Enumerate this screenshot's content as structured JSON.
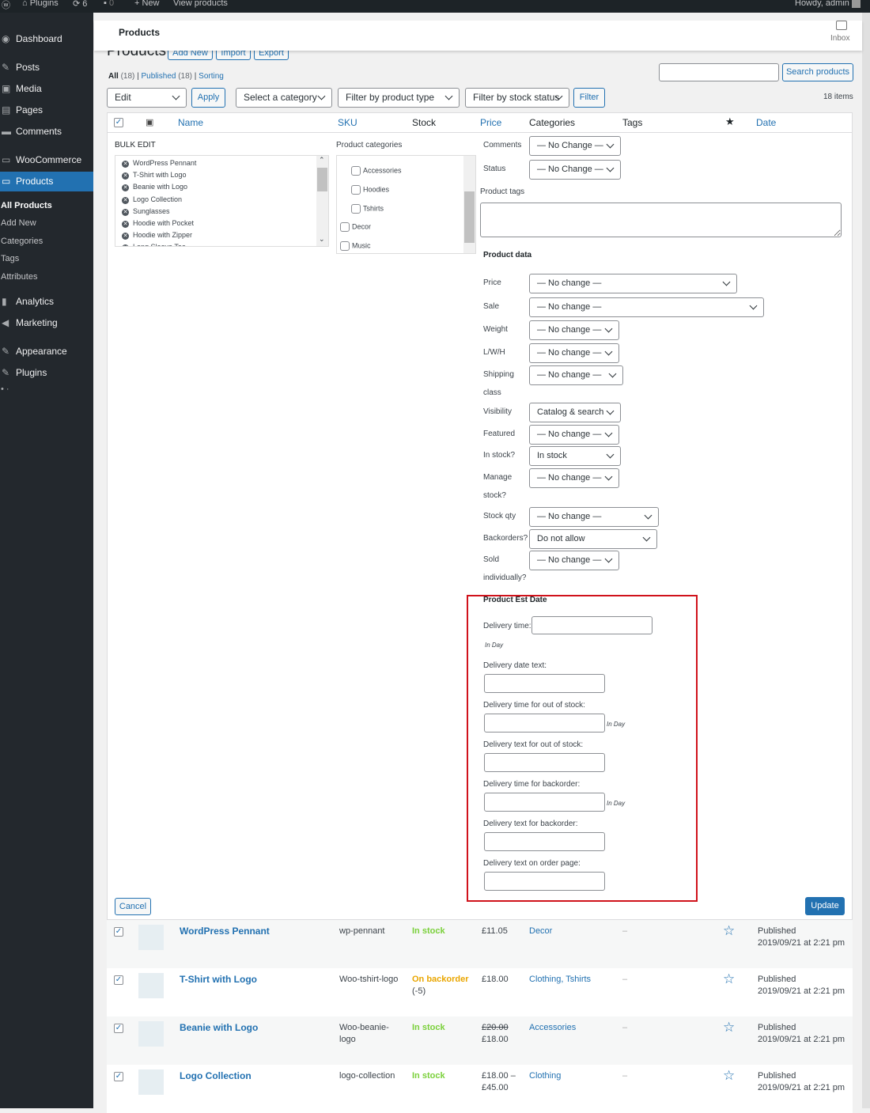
{
  "adminbar": {
    "site": "Plugins",
    "updates": "6",
    "comments": "0",
    "new": "New",
    "view": "View products",
    "howdy": "Howdy, admin"
  },
  "sidebar": {
    "items": [
      {
        "label": "Dashboard",
        "icon": "dashboard-icon"
      },
      {
        "label": "Posts",
        "icon": "pin-icon"
      },
      {
        "label": "Media",
        "icon": "media-icon"
      },
      {
        "label": "Pages",
        "icon": "pages-icon"
      },
      {
        "label": "Comments",
        "icon": "comment-icon"
      },
      {
        "label": "WooCommerce",
        "icon": "woo-icon"
      },
      {
        "label": "Products",
        "icon": "products-icon"
      }
    ],
    "submenu": [
      "All Products",
      "Add New",
      "Categories",
      "Tags",
      "Attributes"
    ],
    "items2": [
      {
        "label": "Analytics"
      },
      {
        "label": "Marketing"
      },
      {
        "label": "Appearance"
      },
      {
        "label": "Plugins"
      }
    ],
    "more": "• ·"
  },
  "topbar": {
    "title": "Products",
    "inbox": "Inbox"
  },
  "page": {
    "title": "Products",
    "add_new": "Add New",
    "import": "Import",
    "export": "Export",
    "views": {
      "all": "All",
      "all_count": "(18)",
      "published": "Published",
      "published_count": "(18)",
      "sorting": "Sorting"
    },
    "search_placeholder": "",
    "search_button": "Search products",
    "bulk_action": "Edit",
    "apply": "Apply",
    "filters": [
      "Select a category",
      "Filter by product type",
      "Filter by stock status"
    ],
    "filter_button": "Filter",
    "items_count": "18 items"
  },
  "columns": {
    "name": "Name",
    "sku": "SKU",
    "stock": "Stock",
    "price": "Price",
    "categories": "Categories",
    "tags": "Tags",
    "date": "Date"
  },
  "bulk_edit": {
    "title": "BULK EDIT",
    "products": [
      "WordPress Pennant",
      "T-Shirt with Logo",
      "Beanie with Logo",
      "Logo Collection",
      "Sunglasses",
      "Hoodie with Pocket",
      "Hoodie with Zipper",
      "Long Sleeve Tee"
    ],
    "categories_label": "Product categories",
    "categories": [
      "Accessories",
      "Hoodies",
      "Tshirts",
      "Decor",
      "Music"
    ],
    "comments_label": "Comments",
    "comments_value": "— No Change —",
    "status_label": "Status",
    "status_value": "— No Change —",
    "tags_label": "Product tags",
    "product_data": "Product data",
    "fields": [
      {
        "label": "Price",
        "value": "— No change —"
      },
      {
        "label": "Sale",
        "value": "— No change —"
      },
      {
        "label": "Weight",
        "value": "— No change —"
      },
      {
        "label": "L/W/H",
        "value": "— No change —"
      },
      {
        "label": "Shipping",
        "label2": "class",
        "value": "— No change —"
      },
      {
        "label": "Visibility",
        "value": "Catalog & search"
      },
      {
        "label": "Featured",
        "value": "— No change —"
      },
      {
        "label": "In stock?",
        "value": "In stock"
      },
      {
        "label": "Manage",
        "label2": "stock?",
        "value": "— No change —"
      },
      {
        "label": "Stock qty",
        "value": "— No change —"
      },
      {
        "label": "Backorders?",
        "value": "Do not allow"
      },
      {
        "label": "Sold",
        "label2": "individually?",
        "value": "— No change —"
      }
    ],
    "est": {
      "title": "Product Est Date",
      "delivery_time": "Delivery time:",
      "in_day": "In Day",
      "delivery_date_text": "Delivery date text:",
      "oos_time": "Delivery time for out of stock:",
      "oos_text": "Delivery text for out of stock:",
      "bo_time": "Delivery time for backorder:",
      "bo_text": "Delivery text for backorder:",
      "order_text": "Delivery text on order page:"
    },
    "cancel": "Cancel",
    "update": "Update"
  },
  "rows": [
    {
      "name": "WordPress Pennant",
      "sku": "wp-pennant",
      "stock": "In stock",
      "stock_extra": "",
      "price": "£11.05",
      "price2": "",
      "categories": "Decor",
      "tags": "–",
      "status": "Published",
      "date": "2019/09/21 at 2:21 pm"
    },
    {
      "name": "T-Shirt with Logo",
      "sku": "Woo-tshirt-logo",
      "stock": "On backorder",
      "stock_extra": "(-5)",
      "price": "£18.00",
      "price2": "",
      "categories": "Clothing, Tshirts",
      "tags": "–",
      "status": "Published",
      "date": "2019/09/21 at 2:21 pm"
    },
    {
      "name": "Beanie with Logo",
      "sku": "Woo-beanie-logo",
      "stock": "In stock",
      "stock_extra": "",
      "price": "£20.00",
      "price2": "£18.00",
      "categories": "Accessories",
      "tags": "–",
      "status": "Published",
      "date": "2019/09/21 at 2:21 pm"
    },
    {
      "name": "Logo Collection",
      "sku": "logo-collection",
      "stock": "In stock",
      "stock_extra": "",
      "price": "£18.00 –",
      "price2": "£45.00",
      "categories": "Clothing",
      "tags": "–",
      "status": "Published",
      "date": "2019/09/21 at 2:21 pm"
    }
  ],
  "colors": {
    "accent": "#2271b1",
    "in_stock": "#7ad03a",
    "backorder": "#eaa600",
    "highlight": "#d63638"
  }
}
